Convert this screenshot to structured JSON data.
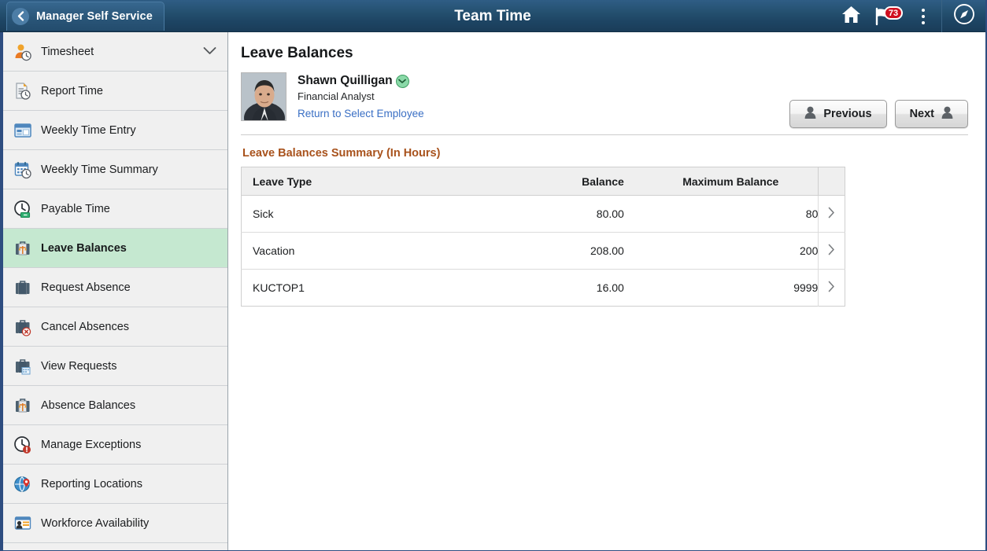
{
  "header": {
    "back_label": "Manager Self Service",
    "back_icon": "chevron-left-icon",
    "title": "Team Time",
    "home_icon": "home-icon",
    "notifications_icon": "flag-icon",
    "notifications_count": "73",
    "actions_icon": "three-dots-icon",
    "navigator_icon": "compass-icon",
    "bg_color": "#24506f"
  },
  "sidebar": {
    "items": [
      {
        "label": "Timesheet",
        "icon": "person-clock-icon",
        "expandable": true,
        "chevron": "chevron-down-icon",
        "active": false
      },
      {
        "label": "Report Time",
        "icon": "document-clock-icon",
        "expandable": false,
        "active": false
      },
      {
        "label": "Weekly Time Entry",
        "icon": "window-grid-icon",
        "expandable": false,
        "active": false
      },
      {
        "label": "Weekly Time Summary",
        "icon": "calendar-clock-icon",
        "expandable": false,
        "active": false
      },
      {
        "label": "Payable Time",
        "icon": "clock-money-icon",
        "expandable": false,
        "active": false
      },
      {
        "label": "Leave Balances",
        "icon": "briefcase-scale-icon",
        "expandable": false,
        "active": true
      },
      {
        "label": "Request Absence",
        "icon": "briefcase-icon",
        "expandable": false,
        "active": false
      },
      {
        "label": "Cancel Absences",
        "icon": "briefcase-cancel-icon",
        "expandable": false,
        "active": false
      },
      {
        "label": "View Requests",
        "icon": "briefcase-list-icon",
        "expandable": false,
        "active": false
      },
      {
        "label": "Absence Balances",
        "icon": "briefcase-scale-icon",
        "expandable": false,
        "active": false
      },
      {
        "label": "Manage Exceptions",
        "icon": "clock-alert-icon",
        "expandable": false,
        "active": false
      },
      {
        "label": "Reporting Locations",
        "icon": "globe-pin-icon",
        "expandable": false,
        "active": false
      },
      {
        "label": "Workforce Availability",
        "icon": "window-person-icon",
        "expandable": false,
        "active": false
      }
    ],
    "active_bg_color": "#c5e8d0",
    "bg_color": "#f0f0f0"
  },
  "main": {
    "page_title": "Leave Balances",
    "employee": {
      "avatar": "employee-photo",
      "name": "Shawn Quilligan",
      "status_icon": "chevron-down-circle-icon",
      "job_title": "Financial Analyst",
      "return_link": "Return to Select Employee"
    },
    "previous_button": {
      "label": "Previous",
      "icon": "person-icon"
    },
    "next_button": {
      "label": "Next",
      "icon": "person-icon"
    },
    "section_title": "Leave Balances Summary (In Hours)",
    "section_title_color": "#a8521c",
    "table": {
      "columns": [
        "Leave Type",
        "Balance",
        "Maximum Balance"
      ],
      "row_arrow_icon": "chevron-right-icon",
      "rows": [
        {
          "leave_type": "Sick",
          "balance": "80.00",
          "maximum_balance": "80"
        },
        {
          "leave_type": "Vacation",
          "balance": "208.00",
          "maximum_balance": "200"
        },
        {
          "leave_type": "KUCTOP1",
          "balance": "16.00",
          "maximum_balance": "9999"
        }
      ]
    }
  }
}
